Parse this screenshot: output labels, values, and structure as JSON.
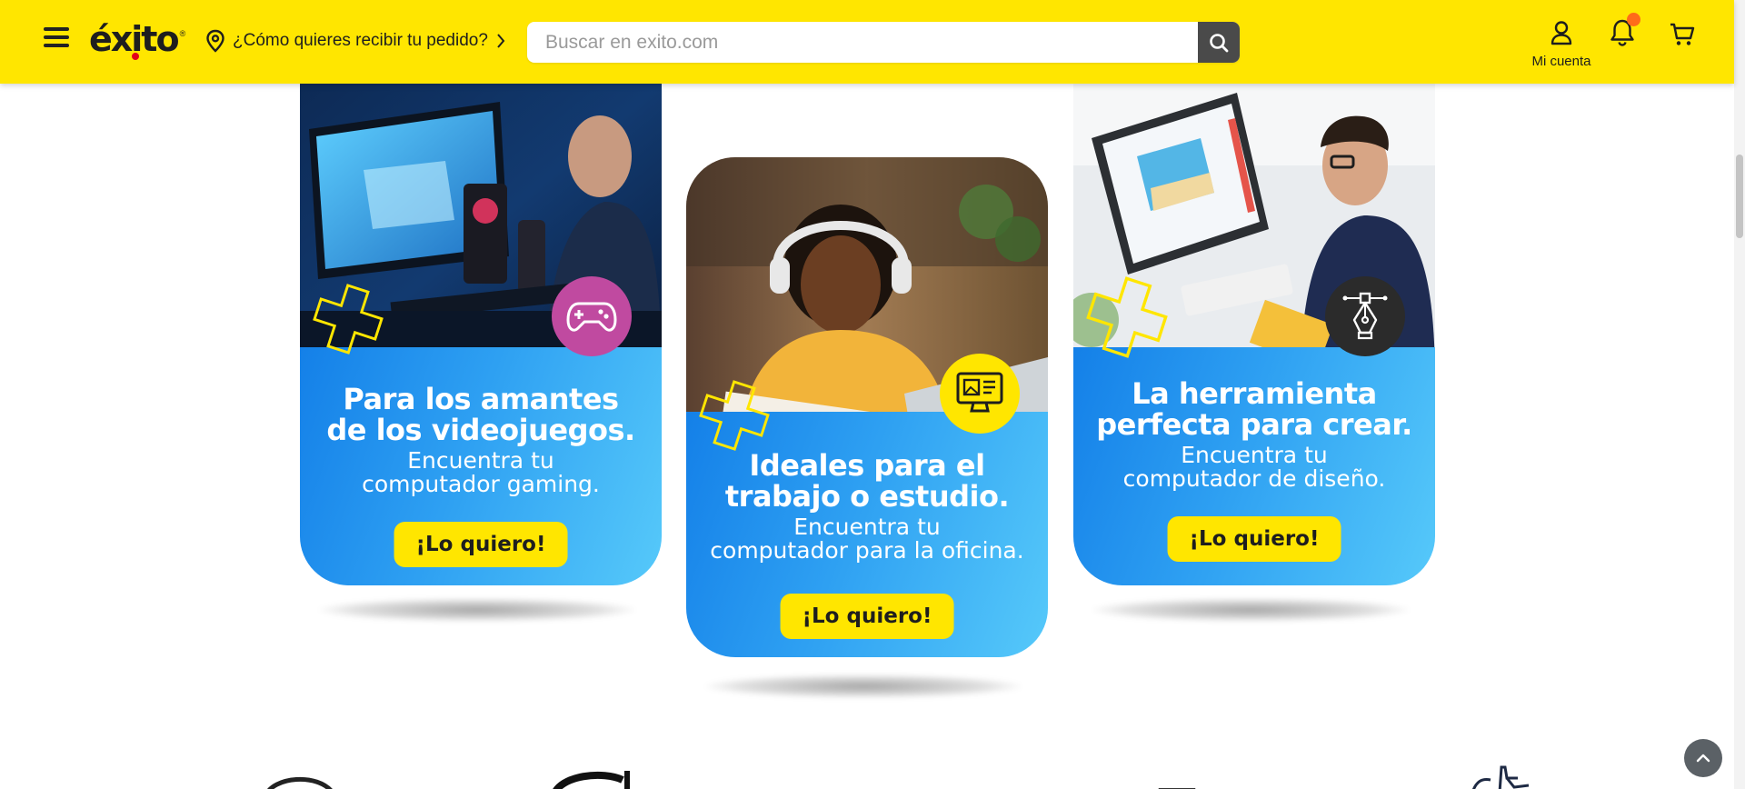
{
  "header": {
    "logo_text": "éxito",
    "location_label": "¿Cómo quieres recibir tu pedido?",
    "search_placeholder": "Buscar en exito.com",
    "account_label": "Mi cuenta"
  },
  "banners": [
    {
      "headline_1": "Para los amantes",
      "headline_2": "de los videojuegos.",
      "sub_1": "Encuentra tu",
      "sub_2": "computador gaming.",
      "cta": "¡Lo quiero!",
      "icon": "gamepad-icon",
      "badge_color": "#c04aa0"
    },
    {
      "headline_1": "Ideales para el",
      "headline_2": "trabajo o estudio.",
      "sub_1": "Encuentra tu",
      "sub_2": "computador para la oficina.",
      "cta": "¡Lo quiero!",
      "icon": "monitor-icon",
      "badge_color": "#ffe600"
    },
    {
      "headline_1": "La herramienta",
      "headline_2": "perfecta para crear.",
      "sub_1": "Encuentra tu",
      "sub_2": "computador de diseño.",
      "cta": "¡Lo quiero!",
      "icon": "pen-tool-icon",
      "badge_color": "#2b2b2b"
    }
  ],
  "colors": {
    "brand_yellow": "#ffe600",
    "banner_blue": "#2ea0f2",
    "notification_dot": "#ff6b1a"
  }
}
